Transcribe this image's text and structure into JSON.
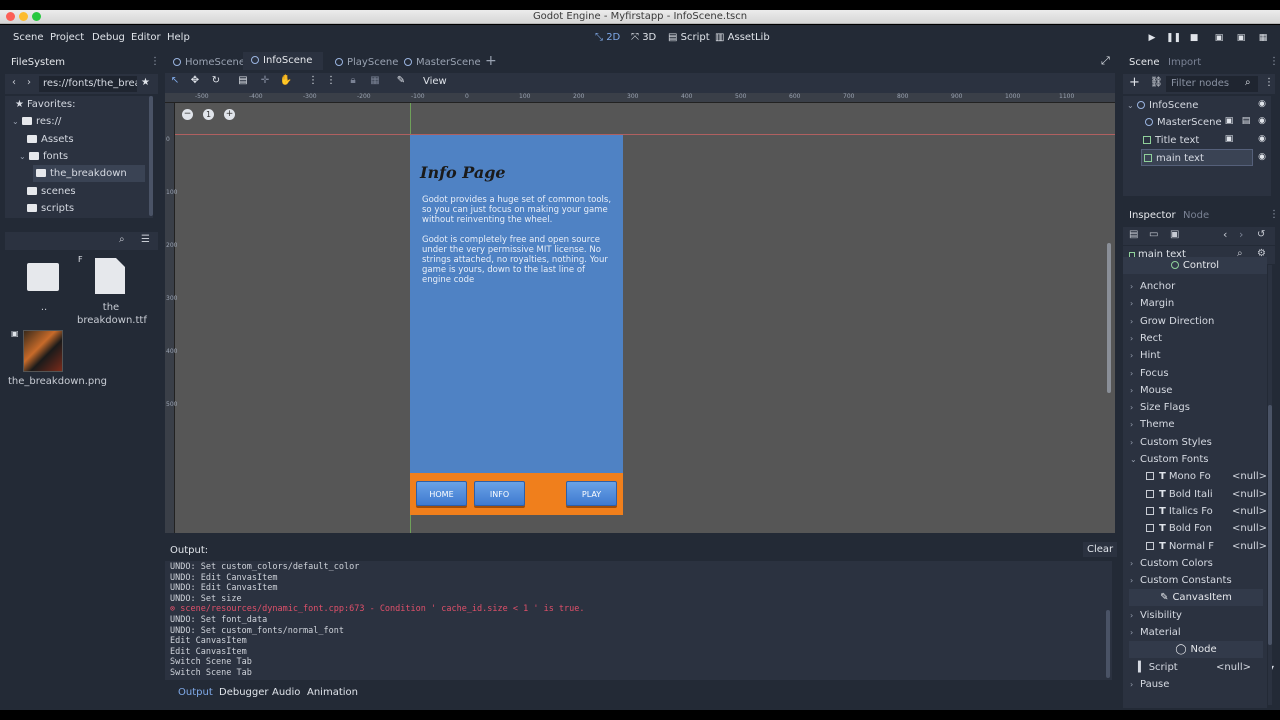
{
  "window": {
    "title": "Godot Engine - Myfirstapp - InfoScene.tscn"
  },
  "menubar": {
    "menus": [
      "Scene",
      "Project",
      "Debug",
      "Editor",
      "Help"
    ],
    "workspaces": [
      "2D",
      "3D",
      "Script",
      "AssetLib"
    ],
    "active_workspace": "2D"
  },
  "filesystem": {
    "tab": "FileSystem",
    "path": "res://fonts/the_brea",
    "favorites_label": "Favorites:",
    "tree": [
      {
        "label": "res://"
      },
      {
        "label": "Assets"
      },
      {
        "label": "fonts"
      },
      {
        "label": "the_breakdown"
      },
      {
        "label": "scenes"
      },
      {
        "label": "scripts"
      }
    ],
    "files": [
      {
        "label": ".."
      },
      {
        "label": "the breakdown.ttf"
      },
      {
        "label": "the_breakdown.png"
      }
    ]
  },
  "editor_tabs": [
    "HomeScene",
    "InfoScene",
    "PlayScene",
    "MasterScene"
  ],
  "active_tab": "InfoScene",
  "toolbar": {
    "view_label": "View"
  },
  "ruler": [
    "-500",
    "-400",
    "-300",
    "-200",
    "-100",
    "0",
    "100",
    "200",
    "300",
    "400",
    "500",
    "600",
    "700",
    "800",
    "900",
    "1000",
    "1100"
  ],
  "vruler": [
    "0",
    "100",
    "200",
    "300",
    "400",
    "500"
  ],
  "phone": {
    "title": "Info Page",
    "para1": "Godot provides a huge set of common tools, so you can just focus on making your game without reinventing the wheel.",
    "para2": "Godot is completely free and open source under the very permissive MIT license. No strings attached, no royalties, nothing. Your game is yours, down to the last line of engine code",
    "buttons": {
      "home": "HOME",
      "info": "INFO",
      "play": "PLAY"
    },
    "bg_color": "#4f82c4",
    "bar_color": "#f07f1c"
  },
  "output": {
    "title": "Output:",
    "clear": "Clear",
    "lines": [
      {
        "text": "UNDO: Set custom_colors/default_color",
        "error": false
      },
      {
        "text": "UNDO: Edit CanvasItem",
        "error": false
      },
      {
        "text": "UNDO: Edit CanvasItem",
        "error": false
      },
      {
        "text": "UNDO: Set size",
        "error": false
      },
      {
        "text": "scene/resources/dynamic_font.cpp:673 - Condition ' cache_id.size < 1 ' is true.",
        "error": true
      },
      {
        "text": "UNDO: Set font_data",
        "error": false
      },
      {
        "text": "UNDO: Set custom_fonts/normal_font",
        "error": false
      },
      {
        "text": "Edit CanvasItem",
        "error": false
      },
      {
        "text": "Edit CanvasItem",
        "error": false
      },
      {
        "text": "Switch Scene Tab",
        "error": false
      },
      {
        "text": "Switch Scene Tab",
        "error": false
      }
    ],
    "bottom_tabs": [
      "Output",
      "Debugger",
      "Audio",
      "Animation"
    ]
  },
  "scene_dock": {
    "tabs": [
      "Scene",
      "Import"
    ],
    "filter_placeholder": "Filter nodes",
    "nodes": [
      "InfoScene",
      "MasterScene",
      "Title text",
      "main text"
    ]
  },
  "inspector": {
    "tabs": [
      "Inspector",
      "Node"
    ],
    "object": "main text",
    "control_header": "Control",
    "sections": [
      "Anchor",
      "Margin",
      "Grow Direction",
      "Rect",
      "Hint",
      "Focus",
      "Mouse",
      "Size Flags",
      "Theme",
      "Custom Styles",
      "Custom Fonts"
    ],
    "font_props": [
      {
        "name": "Mono Fo",
        "value": "<null>"
      },
      {
        "name": "Bold Itali",
        "value": "<null>"
      },
      {
        "name": "Italics Fo",
        "value": "<null>"
      },
      {
        "name": "Bold Fon",
        "value": "<null>"
      },
      {
        "name": "Normal F",
        "value": "<null>"
      }
    ],
    "more_sections": [
      "Custom Colors",
      "Custom Constants"
    ],
    "canvasitem_header": "CanvasItem",
    "canvas_sections": [
      "Visibility",
      "Material"
    ],
    "node_header": "Node",
    "script_label": "Script",
    "script_value": "<null>",
    "pause_label": "Pause"
  },
  "colors": {
    "accent": "#7fa9e8",
    "error": "#e0506a",
    "bg": "#232a36",
    "panel": "#2b3240"
  }
}
